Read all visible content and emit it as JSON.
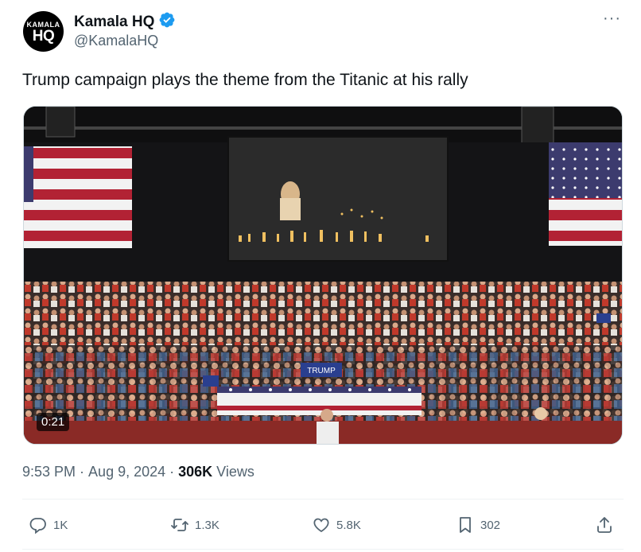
{
  "author": {
    "avatar_top": "KAMALA",
    "avatar_bottom": "HQ",
    "name": "Kamala HQ",
    "handle": "@KamalaHQ",
    "verified_color": "#1d9bf0"
  },
  "tweet": {
    "text": "Trump campaign plays the theme from the Titanic at his rally",
    "more_icon": "more-icon"
  },
  "media": {
    "type": "video",
    "duration": "0:21",
    "screen_text": "",
    "banner_sign": "TRUMP"
  },
  "meta": {
    "time": "9:53 PM",
    "separator": "·",
    "date": "Aug 9, 2024",
    "views_count": "306K",
    "views_label": "Views"
  },
  "actions": {
    "replies": "1K",
    "reposts": "1.3K",
    "likes": "5.8K",
    "bookmarks": "302"
  },
  "colors": {
    "text": "#0f1419",
    "secondary": "#536471",
    "accent": "#1d9bf0"
  }
}
